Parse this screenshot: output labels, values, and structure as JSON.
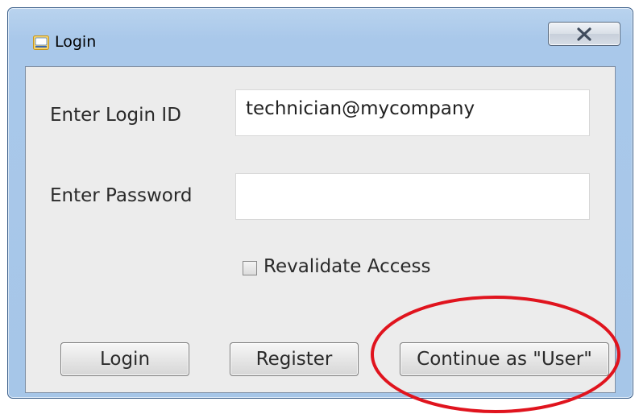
{
  "window": {
    "title": "Login",
    "icon": "app-logo-icon",
    "close_icon": "close-x-icon"
  },
  "form": {
    "login_id_label": "Enter Login ID",
    "login_id_value": "technician@mycompany",
    "password_label": "Enter Password",
    "password_value": "",
    "revalidate_label": "Revalidate Access",
    "revalidate_checked": false
  },
  "buttons": {
    "login": "Login",
    "register": "Register",
    "continue_user": "Continue as \"User\""
  },
  "colors": {
    "annotation_circle": "#e0141e",
    "title_bar": "#a9c8ea",
    "client_background": "#ececec"
  }
}
